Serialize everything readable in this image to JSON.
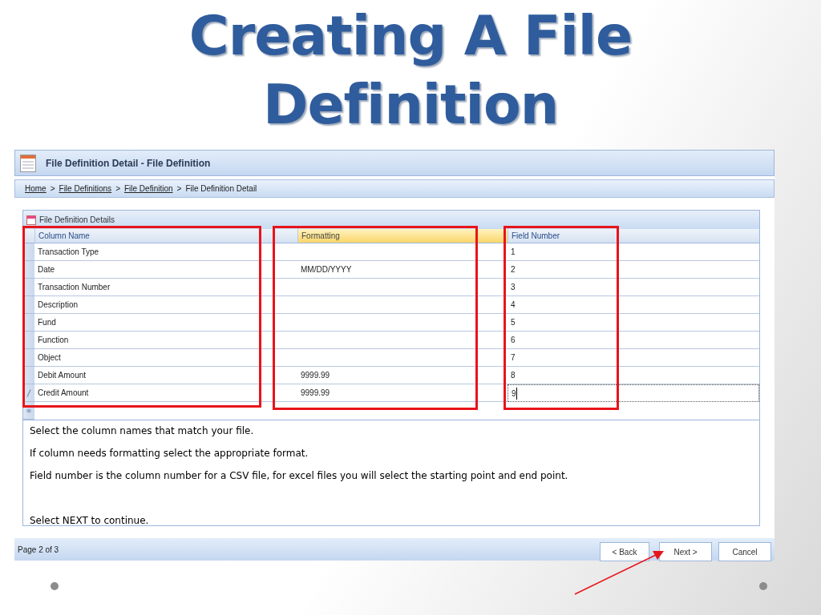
{
  "slide_title": [
    "Creating A File",
    "Definition"
  ],
  "window": {
    "title": "File Definition Detail - File Definition"
  },
  "breadcrumb": [
    {
      "label": "Home",
      "link": true
    },
    {
      "label": ">",
      "link": false
    },
    {
      "label": "File Definitions",
      "link": true
    },
    {
      "label": ">",
      "link": false
    },
    {
      "label": "File Definition",
      "link": true
    },
    {
      "label": ">",
      "link": false
    },
    {
      "label": "File Definition Detail",
      "link": false
    }
  ],
  "panel": {
    "title": "File Definition Details"
  },
  "table": {
    "columns": [
      {
        "label": "Column Name",
        "selected": false
      },
      {
        "label": "Formatting",
        "selected": true
      },
      {
        "label": "Field Number",
        "selected": false
      }
    ],
    "rows": [
      {
        "cells": [
          "Transaction Type",
          "",
          "1"
        ],
        "editing": false
      },
      {
        "cells": [
          "Date",
          "MM/DD/YYYY",
          "2"
        ],
        "editing": false
      },
      {
        "cells": [
          "Transaction Number",
          "",
          "3"
        ],
        "editing": false
      },
      {
        "cells": [
          "Description",
          "",
          "4"
        ],
        "editing": false
      },
      {
        "cells": [
          "Fund",
          "",
          "5"
        ],
        "editing": false
      },
      {
        "cells": [
          "Function",
          "",
          "6"
        ],
        "editing": false
      },
      {
        "cells": [
          "Object",
          "",
          "7"
        ],
        "editing": false
      },
      {
        "cells": [
          "Debit Amount",
          "9999.99",
          "8"
        ],
        "editing": false
      },
      {
        "cells": [
          "Credit Amount",
          "9999.99",
          "9"
        ],
        "editing": true
      }
    ]
  },
  "instructions": [
    "Select the column names that match your file.",
    "If column needs formatting select the appropriate format.",
    "Field number is the column number for a CSV file, for excel files you will select the starting point and end point.",
    "Select NEXT to continue."
  ],
  "status_bar": {
    "page": "Page 2 of 3"
  },
  "buttons": [
    "< Back",
    "Next >",
    "Cancel"
  ]
}
